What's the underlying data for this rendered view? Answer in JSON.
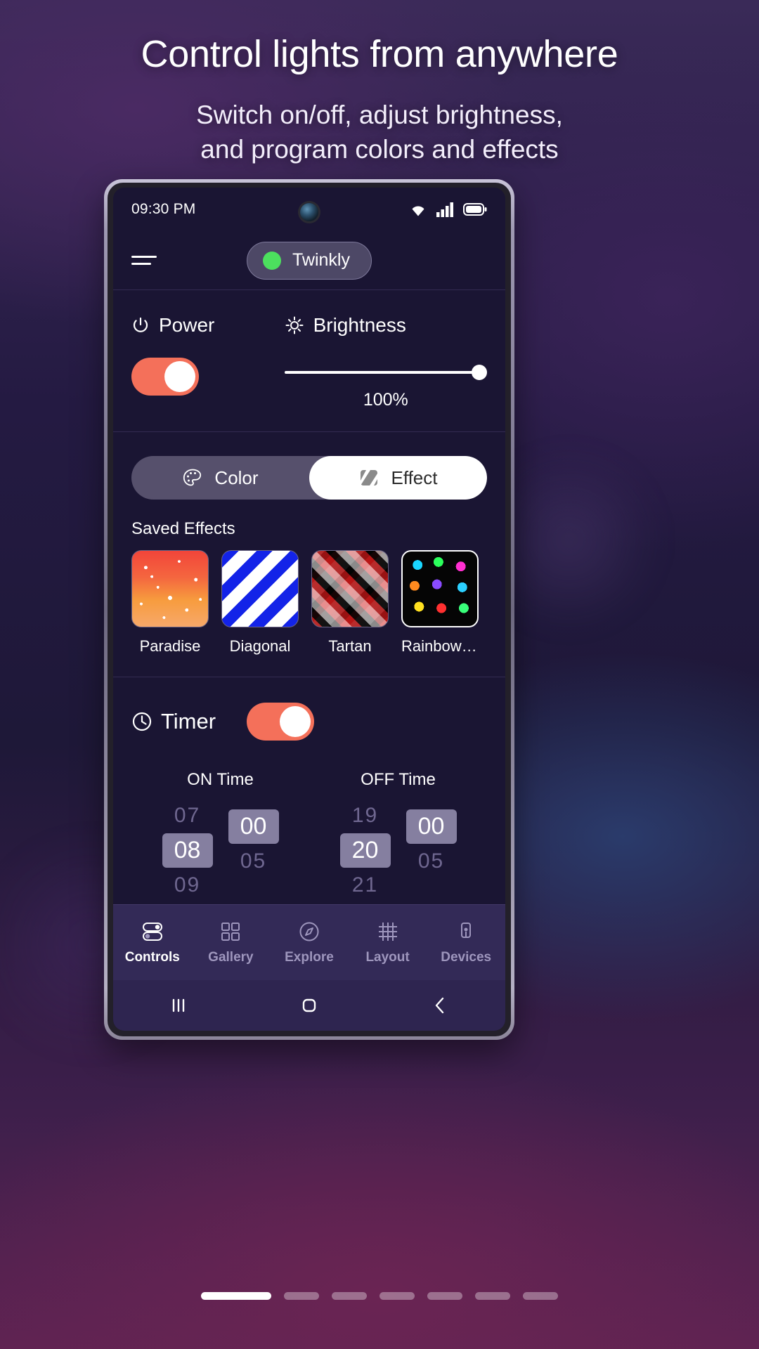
{
  "promo": {
    "title": "Control lights from anywhere",
    "subtitle_line1": "Switch on/off, adjust brightness,",
    "subtitle_line2": "and program colors and effects"
  },
  "status_bar": {
    "time": "09:30 PM",
    "icons": [
      "wifi-icon",
      "cellular-signal-icon",
      "battery-icon"
    ]
  },
  "app_bar": {
    "menu_icon": "hamburger-menu-icon",
    "device_name": "Twinkly",
    "device_status_color": "#4ce05e"
  },
  "power_section": {
    "power_label": "Power",
    "power_icon": "power-icon",
    "power_on": true,
    "brightness_label": "Brightness",
    "brightness_icon": "brightness-sun-icon",
    "brightness_value": "100%",
    "brightness_percent": 100
  },
  "mode_tabs": {
    "color": {
      "label": "Color",
      "icon": "palette-icon",
      "active": false
    },
    "effect": {
      "label": "Effect",
      "icon": "effect-stripes-icon",
      "active": true
    }
  },
  "saved_effects": {
    "heading": "Saved Effects",
    "items": [
      {
        "name": "Paradise",
        "art": "t-paradise",
        "selected": false
      },
      {
        "name": "Diagonal",
        "art": "t-diagonal",
        "selected": false
      },
      {
        "name": "Tartan",
        "art": "t-tartan",
        "selected": false
      },
      {
        "name": "Rainbow R...",
        "art": "t-rainbow",
        "selected": true
      }
    ]
  },
  "timer": {
    "label": "Timer",
    "icon": "clock-icon",
    "enabled": true,
    "on_time": {
      "title": "ON Time",
      "hour": {
        "prev": "07",
        "current": "08",
        "next": "09"
      },
      "minute": {
        "prev": "",
        "current": "00",
        "next": "05"
      }
    },
    "off_time": {
      "title": "OFF Time",
      "hour": {
        "prev": "19",
        "current": "20",
        "next": "21"
      },
      "minute": {
        "prev": "",
        "current": "00",
        "next": "05"
      }
    }
  },
  "bottom_nav": [
    {
      "label": "Controls",
      "icon": "toggles-icon",
      "active": true
    },
    {
      "label": "Gallery",
      "icon": "grid-icon",
      "active": false
    },
    {
      "label": "Explore",
      "icon": "compass-icon",
      "active": false
    },
    {
      "label": "Layout",
      "icon": "hash-grid-icon",
      "active": false
    },
    {
      "label": "Devices",
      "icon": "device-icon",
      "active": false
    }
  ],
  "system_bar": {
    "recents_icon": "recents-bars-icon",
    "home_icon": "home-square-icon",
    "back_icon": "back-chevron-icon"
  },
  "carousel": {
    "total_dots": 7,
    "active_index": 0
  },
  "colors": {
    "accent": "#f4705a",
    "screen_bg": "#1a1533",
    "nav_bg": "#332a57"
  }
}
